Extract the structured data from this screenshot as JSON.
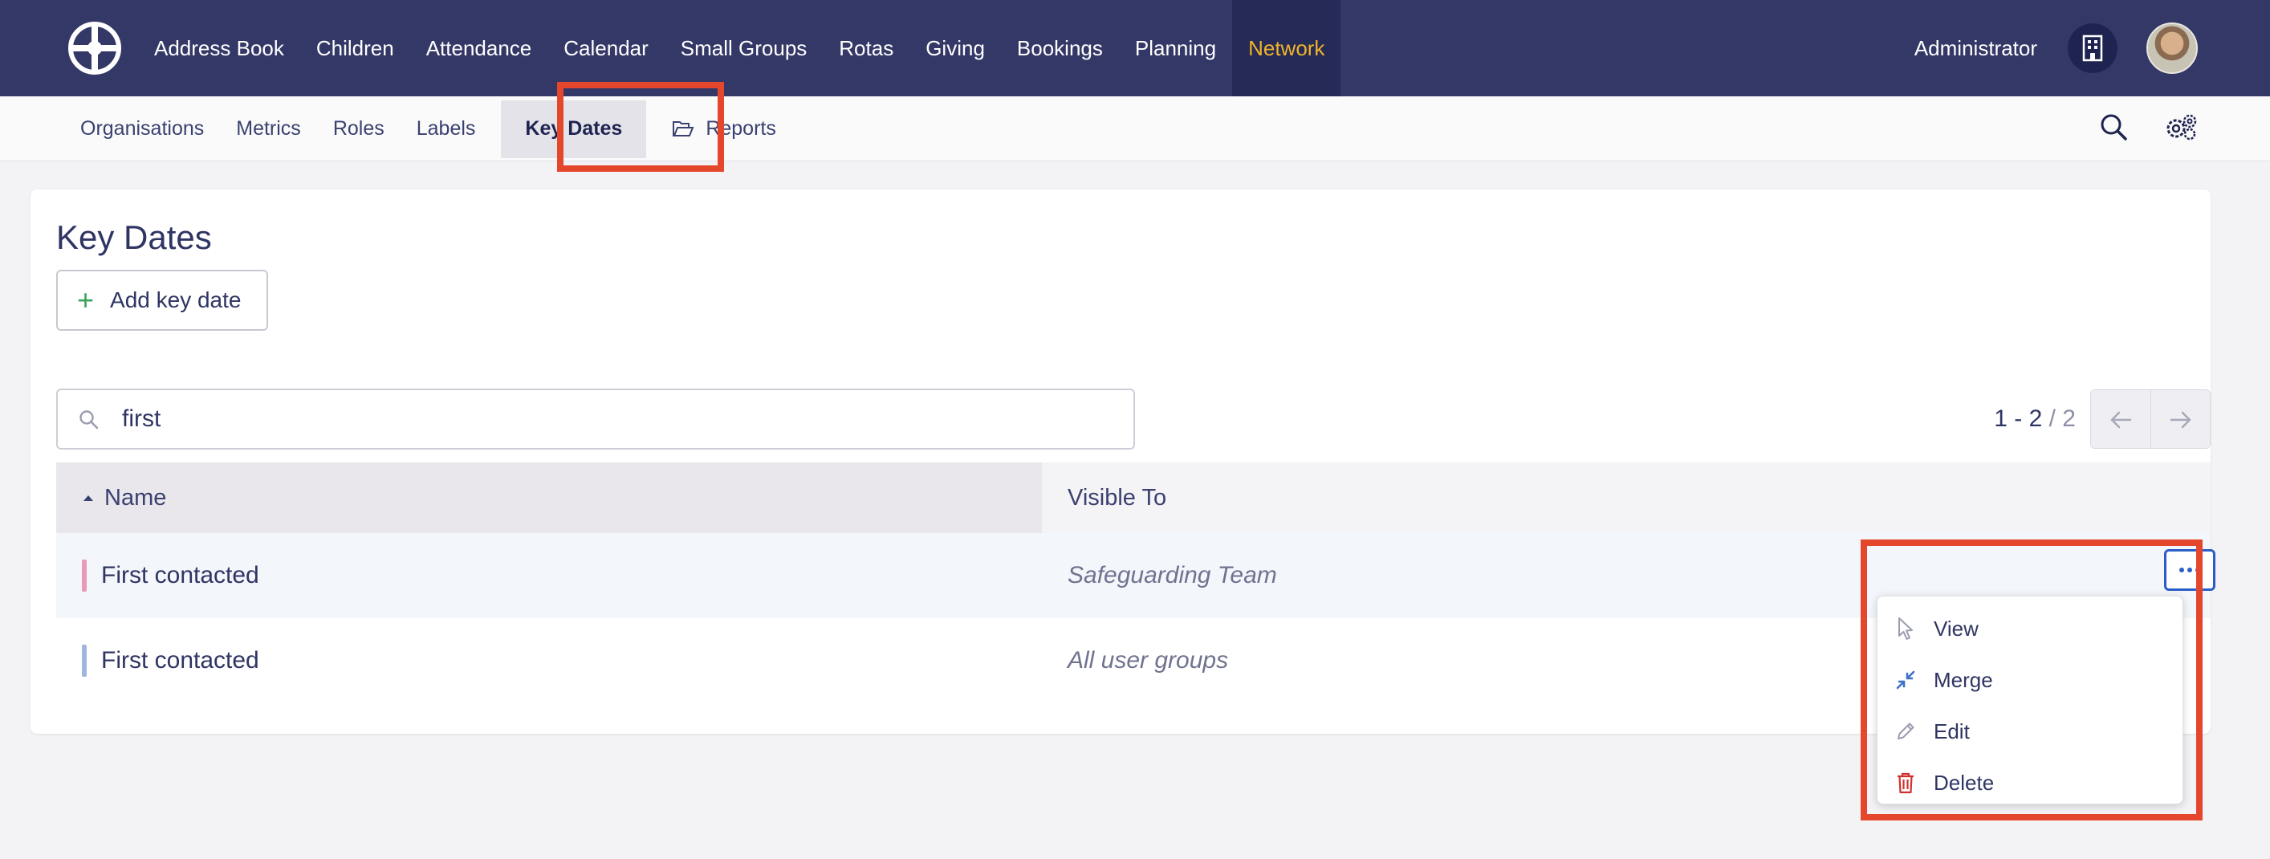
{
  "topnav": {
    "items": [
      "Address Book",
      "Children",
      "Attendance",
      "Calendar",
      "Small Groups",
      "Rotas",
      "Giving",
      "Bookings",
      "Planning",
      "Network"
    ],
    "active": "Network",
    "user_label": "Administrator"
  },
  "subnav": {
    "items": [
      "Organisations",
      "Metrics",
      "Roles",
      "Labels",
      "Key Dates",
      "Reports"
    ],
    "active": "Key Dates"
  },
  "page": {
    "title": "Key Dates",
    "add_button": "Add key date"
  },
  "search": {
    "value": "first"
  },
  "pager": {
    "range": "1 - 2",
    "total": "/ 2"
  },
  "table": {
    "columns": [
      "Name",
      "Visible To"
    ],
    "rows": [
      {
        "name": "First contacted",
        "visible_to": "Safeguarding Team",
        "color": "#e89ab8"
      },
      {
        "name": "First contacted",
        "visible_to": "All user groups",
        "color": "#9fb6dc"
      }
    ]
  },
  "menu": {
    "items": [
      {
        "label": "View",
        "icon": "pointer-icon"
      },
      {
        "label": "Merge",
        "icon": "merge-icon"
      },
      {
        "label": "Edit",
        "icon": "pencil-icon"
      },
      {
        "label": "Delete",
        "icon": "trash-icon"
      }
    ]
  },
  "colors": {
    "topbar": "#343867",
    "active_nav": "#f0b429",
    "highlight": "#e5472c",
    "add_plus": "#3ba55c",
    "delete": "#d0312d"
  }
}
